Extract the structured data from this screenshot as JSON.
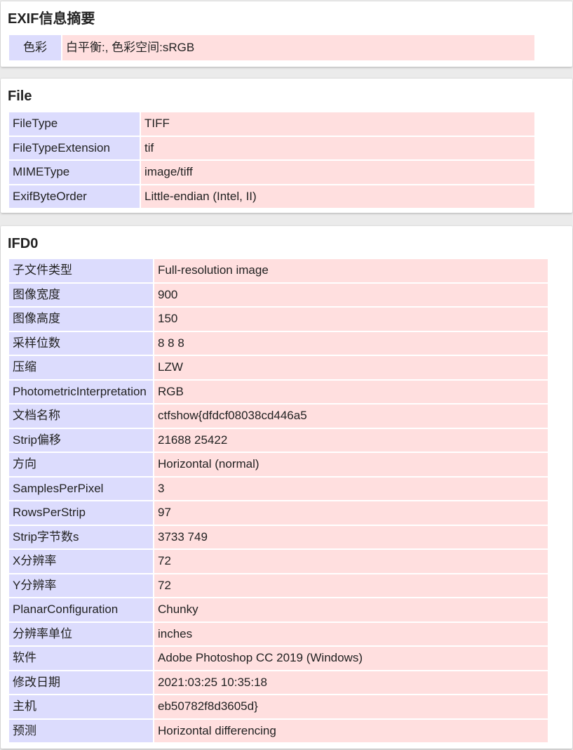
{
  "exif": {
    "title": "EXIF信息摘要",
    "rows": [
      {
        "key": "色彩",
        "value": "白平衡:, 色彩空间:sRGB"
      }
    ]
  },
  "file": {
    "title": "File",
    "rows": [
      {
        "key": "FileType",
        "value": "TIFF"
      },
      {
        "key": "FileTypeExtension",
        "value": "tif"
      },
      {
        "key": "MIMEType",
        "value": "image/tiff"
      },
      {
        "key": "ExifByteOrder",
        "value": "Little-endian (Intel, II)"
      }
    ]
  },
  "ifd0": {
    "title": "IFD0",
    "rows": [
      {
        "key": "子文件类型",
        "value": "Full-resolution image"
      },
      {
        "key": "图像宽度",
        "value": "900"
      },
      {
        "key": "图像高度",
        "value": "150"
      },
      {
        "key": "采样位数",
        "value": "8 8 8"
      },
      {
        "key": "压缩",
        "value": "LZW"
      },
      {
        "key": "PhotometricInterpretation",
        "value": "RGB"
      },
      {
        "key": "文档名称",
        "value": "ctfshow{dfdcf08038cd446a5"
      },
      {
        "key": "Strip偏移",
        "value": "21688 25422"
      },
      {
        "key": "方向",
        "value": "Horizontal (normal)"
      },
      {
        "key": "SamplesPerPixel",
        "value": "3"
      },
      {
        "key": "RowsPerStrip",
        "value": "97"
      },
      {
        "key": "Strip字节数s",
        "value": "3733 749"
      },
      {
        "key": "X分辨率",
        "value": "72"
      },
      {
        "key": "Y分辨率",
        "value": "72"
      },
      {
        "key": "PlanarConfiguration",
        "value": "Chunky"
      },
      {
        "key": "分辨率单位",
        "value": "inches"
      },
      {
        "key": "软件",
        "value": "Adobe Photoshop CC 2019 (Windows)"
      },
      {
        "key": "修改日期",
        "value": "2021:03:25 10:35:18"
      },
      {
        "key": "主机",
        "value": "eb50782f8d3605d}"
      },
      {
        "key": "预测",
        "value": "Horizontal differencing"
      }
    ]
  },
  "colors": {
    "key_bg": "#dcdcfd",
    "value_bg": "#ffdfdf",
    "page_bg": "#ebebeb",
    "card_bg": "#ffffff"
  }
}
